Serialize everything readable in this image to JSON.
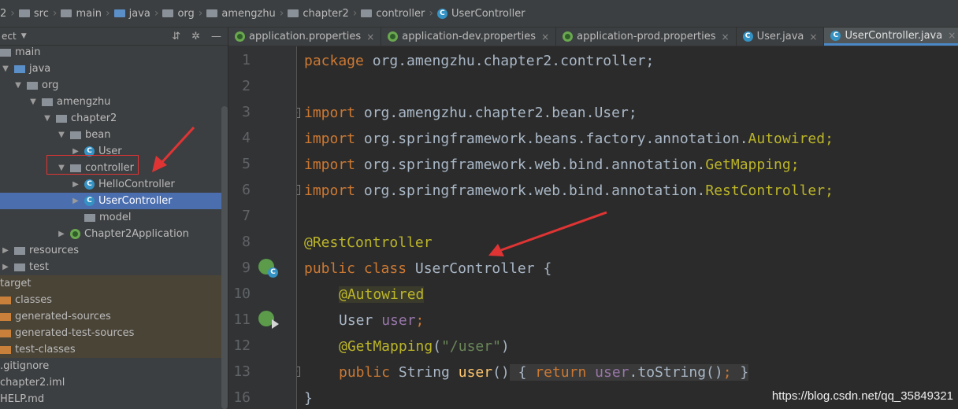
{
  "breadcrumb": [
    {
      "label": "2",
      "icon": "none"
    },
    {
      "label": "src",
      "icon": "folder-icon"
    },
    {
      "label": "main",
      "icon": "folder-icon"
    },
    {
      "label": "java",
      "icon": "source-folder-icon"
    },
    {
      "label": "org",
      "icon": "package-icon"
    },
    {
      "label": "amengzhu",
      "icon": "package-icon"
    },
    {
      "label": "chapter2",
      "icon": "package-icon"
    },
    {
      "label": "controller",
      "icon": "package-icon"
    },
    {
      "label": "UserController",
      "icon": "class-icon"
    }
  ],
  "project_panel": {
    "title": "ect",
    "tree": [
      {
        "label": "main",
        "icon": "folder",
        "arrow": ""
      },
      {
        "label": "java",
        "icon": "source-folder",
        "arrow": "▼"
      },
      {
        "label": "org",
        "icon": "package",
        "arrow": "▼"
      },
      {
        "label": "amengzhu",
        "icon": "package",
        "arrow": "▼"
      },
      {
        "label": "chapter2",
        "icon": "package",
        "arrow": "▼"
      },
      {
        "label": "bean",
        "icon": "package",
        "arrow": "▼"
      },
      {
        "label": "User",
        "icon": "class",
        "arrow": "▶"
      },
      {
        "label": "controller",
        "icon": "package",
        "arrow": "▼"
      },
      {
        "label": "HelloController",
        "icon": "class",
        "arrow": "▶"
      },
      {
        "label": "UserController",
        "icon": "class",
        "arrow": "▶"
      },
      {
        "label": "model",
        "icon": "package",
        "arrow": ""
      },
      {
        "label": "Chapter2Application",
        "icon": "spring-class",
        "arrow": "▶"
      },
      {
        "label": "resources",
        "icon": "resources-folder",
        "arrow": "▶"
      },
      {
        "label": "test",
        "icon": "folder",
        "arrow": "▶"
      },
      {
        "label": "target",
        "icon": "none",
        "arrow": ""
      },
      {
        "label": "classes",
        "icon": "excluded-folder",
        "arrow": ""
      },
      {
        "label": "generated-sources",
        "icon": "excluded-folder",
        "arrow": ""
      },
      {
        "label": "generated-test-sources",
        "icon": "excluded-folder",
        "arrow": ""
      },
      {
        "label": "test-classes",
        "icon": "excluded-folder",
        "arrow": ""
      },
      {
        "label": ".gitignore",
        "icon": "none",
        "arrow": ""
      },
      {
        "label": "chapter2.iml",
        "icon": "none",
        "arrow": ""
      },
      {
        "label": "HELP.md",
        "icon": "none",
        "arrow": ""
      }
    ]
  },
  "tabs": [
    {
      "label": "application.properties",
      "icon": "spring-icon",
      "active": false
    },
    {
      "label": "application-dev.properties",
      "icon": "spring-icon",
      "active": false
    },
    {
      "label": "application-prod.properties",
      "icon": "spring-icon",
      "active": false
    },
    {
      "label": "User.java",
      "icon": "class-icon",
      "active": false
    },
    {
      "label": "UserController.java",
      "icon": "class-icon",
      "active": true
    }
  ],
  "tab_close": "×",
  "editor": {
    "line_numbers": [
      "1",
      "2",
      "3",
      "4",
      "5",
      "6",
      "7",
      "8",
      "9",
      "10",
      "11",
      "12",
      "13",
      "16"
    ],
    "lines": {
      "l1_kw": "package",
      "l1_rest": " org.amengzhu.chapter2.controller;",
      "l3_kw": "import",
      "l3_rest": " org.amengzhu.chapter2.bean.User;",
      "l4_kw": "import",
      "l4_rest": " org.springframework.beans.factory.annotation.",
      "l4_cls": "Autowired;",
      "l5_kw": "import",
      "l5_rest": " org.springframework.web.bind.annotation.",
      "l5_cls": "GetMapping;",
      "l6_kw": "import",
      "l6_rest": " org.springframework.web.bind.annotation.",
      "l6_cls": "RestController;",
      "l8_ann": "@RestController",
      "l9_kw": "public class",
      "l9_rest": " UserController {",
      "l10_ann": "@Autowired",
      "l11_type": "User ",
      "l11_fld": "user",
      "l11_semi": ";",
      "l12_ann": "@GetMapping",
      "l12_p1": "(",
      "l12_str": "\"/user\"",
      "l12_p2": ")",
      "l13_kw": "public",
      "l13_type": " String ",
      "l13_mth": "user",
      "l13_paren": "()",
      "l13_brace1": " { ",
      "l13_ret": "return",
      "l13_fld": " user",
      "l13_call": ".toString()",
      "l13_semi": ";",
      "l13_brace2": " }",
      "l16": "}"
    }
  },
  "watermark": "https://blog.csdn.net/qq_35849321",
  "colors": {
    "keyword": "#cc7832",
    "annotation": "#bbb529",
    "field": "#9876aa",
    "string": "#6a8759",
    "method": "#ffc66d",
    "selection": "#4b6eaf",
    "arrow": "#e03434"
  }
}
